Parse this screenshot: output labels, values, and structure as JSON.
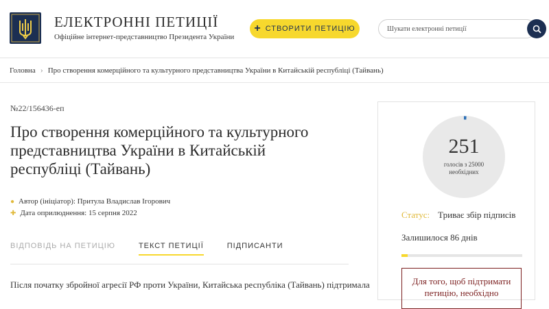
{
  "header": {
    "site_title": "ЕЛЕКТРОННІ ПЕТИЦІЇ",
    "site_subtitle": "Офіційне інтернет-представництво Президента України",
    "create_button": "СТВОРИТИ ПЕТИЦІЮ",
    "search_placeholder": "Шукати електронні петиції"
  },
  "breadcrumb": {
    "home": "Головна",
    "current": "Про створення комерційного та культурного представництва України в Китайській республіці (Тайвань)"
  },
  "petition": {
    "number": "№22/156436-еп",
    "title": "Про створення комерційного та культурного представництва України в Китайській республіці (Тайвань)",
    "author": "Автор (ініціатор): Притула Владислав Ігорович",
    "date": "Дата оприлюднення: 15 серпня 2022",
    "tabs": [
      "ВІДПОВІДЬ НА ПЕТИЦІЮ",
      "ТЕКСТ ПЕТИЦІЇ",
      "ПІДПИСАНТИ"
    ],
    "body_text": "Після початку збройної агресії РФ проти України, Китайська республіка (Тайвань) підтримала"
  },
  "sidebar": {
    "votes": "251",
    "votes_caption": "голосів з 25000 необхідних",
    "votes_fraction": 0.01,
    "status_label": "Статус:",
    "status_value": "Триває збір підписів",
    "remaining": "Залишилося 86 днів",
    "days_progress": 0.05,
    "support_text": "Для того, щоб підтримати петицію, необхідно"
  },
  "colors": {
    "brand_navy": "#1c2f52",
    "accent_yellow": "#f7d82d",
    "gold": "#e0b93a",
    "dark_red": "#7b1f1f"
  },
  "icons": [
    "trident-logo-icon",
    "plus-icon",
    "search-icon",
    "chevron-right-icon",
    "person-icon",
    "plus-small-icon"
  ]
}
